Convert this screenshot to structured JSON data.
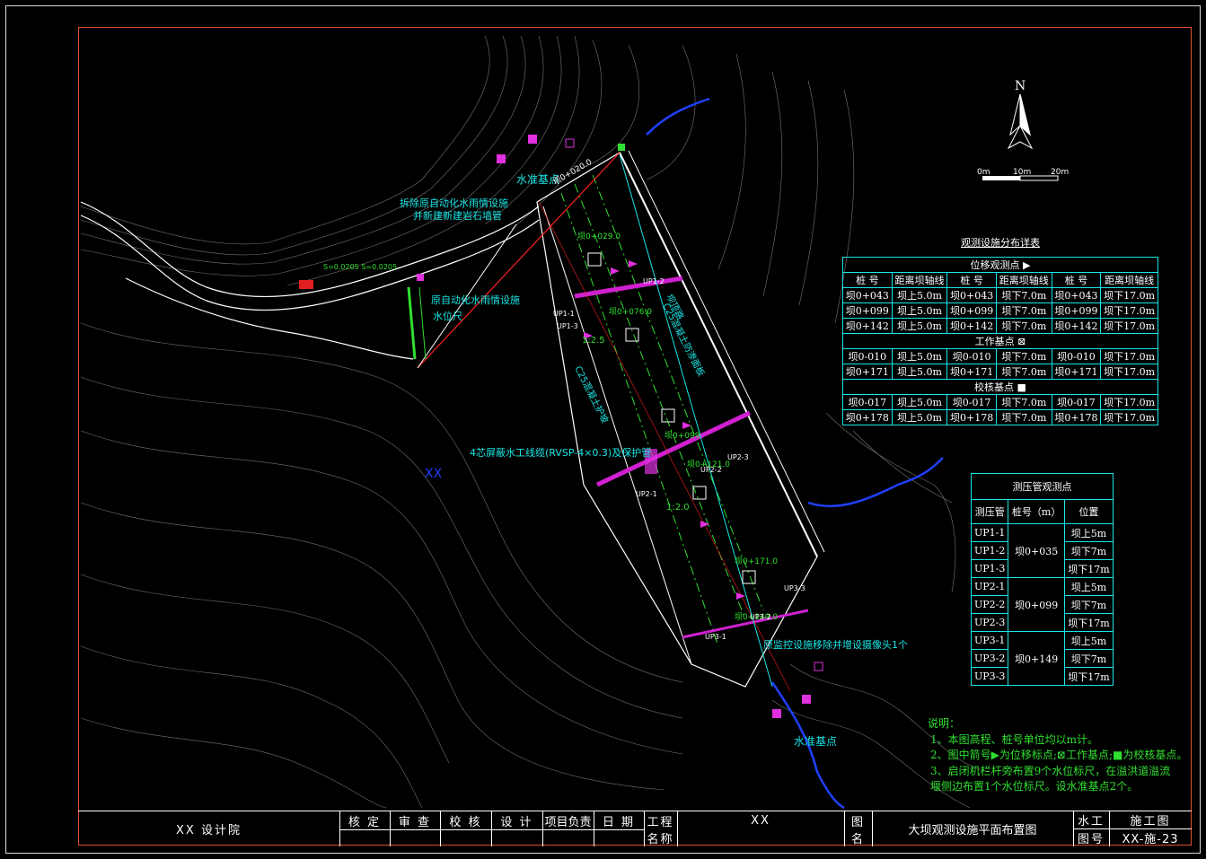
{
  "compass": {
    "north": "N",
    "scale_labels": [
      "0m",
      "10m",
      "20m"
    ]
  },
  "labels": {
    "water_level_base_1": "水准基点",
    "water_level_base_2": "水准基点",
    "auto_station_remove": "拆除原自动化水雨情设施",
    "auto_station_relocate": "并新建新建岩石墙管",
    "auto_station_origin": "原自动化水雨情设施",
    "water_gauge": "水位尺",
    "cable": "4芯屏蔽水工线缆(RVSP-4×0.3)及保护管",
    "dam_crest": "坝顶路",
    "new_monitor": "原监控设施移除并增设摄像头1个",
    "xx_site": "XX",
    "slope_ratio_1": "1:2.5",
    "slope_ratio_2": "1:2.0",
    "station_0": "坝0+020.0",
    "station_1": "坝0+029.0",
    "station_2": "坝0+076.0",
    "station_3": "坝0+099",
    "station_4": "坝0+121.0",
    "station_5": "坝0+149.0",
    "station_6": "坝0+171.0",
    "up_labels": [
      "UP1-1",
      "UP1-2",
      "UP1-3",
      "UP2-1",
      "UP2-2",
      "UP2-3",
      "UP3-1",
      "UP3-2",
      "UP3-3"
    ],
    "berm_1": "C25混凝土护坡",
    "berm_2": "C25混凝土防渗面板",
    "road_label": "S=0.0205 S=0.0205"
  },
  "table1": {
    "title": "观测设施分布详表",
    "section1": "位移观测点 ▶",
    "col_headers": [
      "桩 号",
      "距离坝轴线",
      "桩 号",
      "距离坝轴线",
      "桩 号",
      "距离坝轴线"
    ],
    "rows1": [
      [
        "坝0+043",
        "坝上5.0m",
        "坝0+043",
        "坝下7.0m",
        "坝0+043",
        "坝下17.0m"
      ],
      [
        "坝0+099",
        "坝上5.0m",
        "坝0+099",
        "坝下7.0m",
        "坝0+099",
        "坝下17.0m"
      ],
      [
        "坝0+142",
        "坝上5.0m",
        "坝0+142",
        "坝下7.0m",
        "坝0+142",
        "坝下17.0m"
      ]
    ],
    "section2": "工作基点 ⊠",
    "rows2": [
      [
        "坝0-010",
        "坝上5.0m",
        "坝0-010",
        "坝下7.0m",
        "坝0-010",
        "坝下17.0m"
      ],
      [
        "坝0+171",
        "坝上5.0m",
        "坝0+171",
        "坝下7.0m",
        "坝0+171",
        "坝下17.0m"
      ]
    ],
    "section3": "校核基点 ■",
    "rows3": [
      [
        "坝0-017",
        "坝上5.0m",
        "坝0-017",
        "坝下7.0m",
        "坝0-017",
        "坝下17.0m"
      ],
      [
        "坝0+178",
        "坝上5.0m",
        "坝0+178",
        "坝下7.0m",
        "坝0+178",
        "坝下17.0m"
      ]
    ]
  },
  "table2": {
    "title": "测压管观测点",
    "headers": [
      "测压管",
      "桩号（m）",
      "位置"
    ],
    "groups": [
      {
        "station": "坝0+035",
        "items": [
          [
            "UP1-1",
            "坝上5m"
          ],
          [
            "UP1-2",
            "坝下7m"
          ],
          [
            "UP1-3",
            "坝下17m"
          ]
        ]
      },
      {
        "station": "坝0+099",
        "items": [
          [
            "UP2-1",
            "坝上5m"
          ],
          [
            "UP2-2",
            "坝下7m"
          ],
          [
            "UP2-3",
            "坝下17m"
          ]
        ]
      },
      {
        "station": "坝0+149",
        "items": [
          [
            "UP3-1",
            "坝上5m"
          ],
          [
            "UP3-2",
            "坝下7m"
          ],
          [
            "UP3-3",
            "坝下17m"
          ]
        ]
      }
    ]
  },
  "notes": {
    "title": "说明：",
    "lines": [
      "1、本图高程、桩号单位均以m计。",
      "2、图中箭号▶为位移标点;⊠工作基点;■为校核基点。",
      "3、启闭机栏杆旁布置9个水位标尺，在溢洪道溢流",
      "堰侧边布置1个水位标尺。设水准基点2个。"
    ]
  },
  "title_block": {
    "institute": "XX 设计院",
    "roles": [
      "核 定",
      "审 查",
      "校 核",
      "设 计",
      "项目负责",
      "日 期"
    ],
    "project_label_1": "工程",
    "project_label_2": "名称",
    "project_name": "XX",
    "drawing_label_1": "图",
    "drawing_label_2": "名",
    "drawing_name": "大坝观测设施平面布置图",
    "discipline": "水工",
    "stage": "施工图",
    "number_label": "图号",
    "number": "XX-施-23"
  }
}
